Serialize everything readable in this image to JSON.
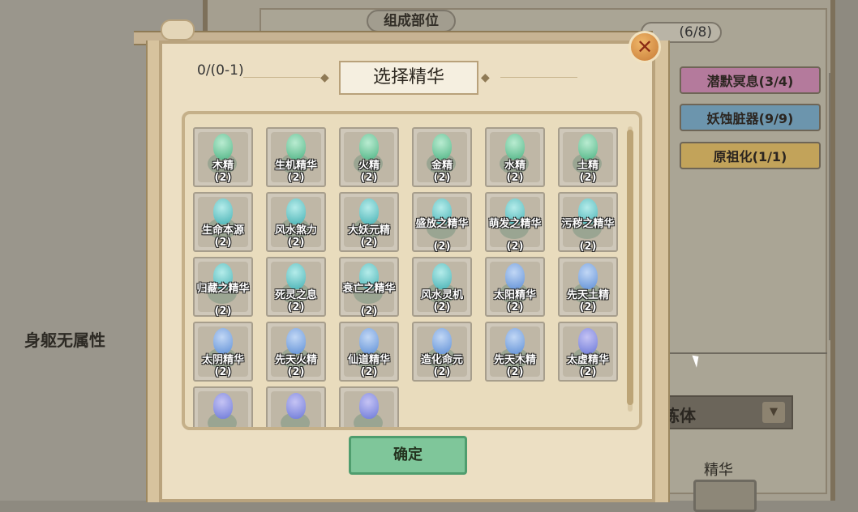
{
  "background": {
    "component_title": "组成部位",
    "count_pill": "(6/8)",
    "body_attribute": "身躯无属性",
    "right_buttons": [
      {
        "label": "潜默冥息(3/4)"
      },
      {
        "label": "妖蚀脏器(9/9)"
      },
      {
        "label": "原祖化(1/1)"
      }
    ],
    "refine_label": "炼体",
    "essence_label": "精华"
  },
  "dialog": {
    "title": "选择精华",
    "selection_count": "0/(0-1)",
    "confirm_label": "确定",
    "close_label": "✕",
    "items": [
      {
        "name": "木精",
        "count": "(2)",
        "color": "green"
      },
      {
        "name": "生机精华",
        "count": "(2)",
        "color": "green"
      },
      {
        "name": "火精",
        "count": "(2)",
        "color": "green"
      },
      {
        "name": "金精",
        "count": "(2)",
        "color": "green"
      },
      {
        "name": "水精",
        "count": "(2)",
        "color": "green"
      },
      {
        "name": "土精",
        "count": "(2)",
        "color": "green"
      },
      {
        "name": "生命本源",
        "count": "(2)",
        "color": "teal"
      },
      {
        "name": "风水煞力",
        "count": "(2)",
        "color": "teal"
      },
      {
        "name": "大妖元精",
        "count": "(2)",
        "color": "teal"
      },
      {
        "name": "盛放之精华",
        "count": "(2)",
        "color": "teal"
      },
      {
        "name": "萌发之精华",
        "count": "(2)",
        "color": "teal"
      },
      {
        "name": "污秽之精华",
        "count": "(2)",
        "color": "teal"
      },
      {
        "name": "归藏之精华",
        "count": "(2)",
        "color": "teal"
      },
      {
        "name": "死灵之息",
        "count": "(2)",
        "color": "teal"
      },
      {
        "name": "衰亡之精华",
        "count": "(2)",
        "color": "teal"
      },
      {
        "name": "风水灵机",
        "count": "(2)",
        "color": "teal"
      },
      {
        "name": "太阳精华",
        "count": "(2)",
        "color": "blue"
      },
      {
        "name": "先天土精",
        "count": "(2)",
        "color": "blue"
      },
      {
        "name": "太阴精华",
        "count": "(2)",
        "color": "blue"
      },
      {
        "name": "先天火精",
        "count": "(2)",
        "color": "blue"
      },
      {
        "name": "仙道精华",
        "count": "(2)",
        "color": "blue"
      },
      {
        "name": "造化命元",
        "count": "(2)",
        "color": "blue"
      },
      {
        "name": "先天木精",
        "count": "(2)",
        "color": "blue"
      },
      {
        "name": "太虚精华",
        "count": "(2)",
        "color": "purple"
      },
      {
        "name": "",
        "count": "",
        "color": "purple"
      },
      {
        "name": "",
        "count": "",
        "color": "purple"
      },
      {
        "name": "",
        "count": "",
        "color": "purple"
      }
    ]
  }
}
